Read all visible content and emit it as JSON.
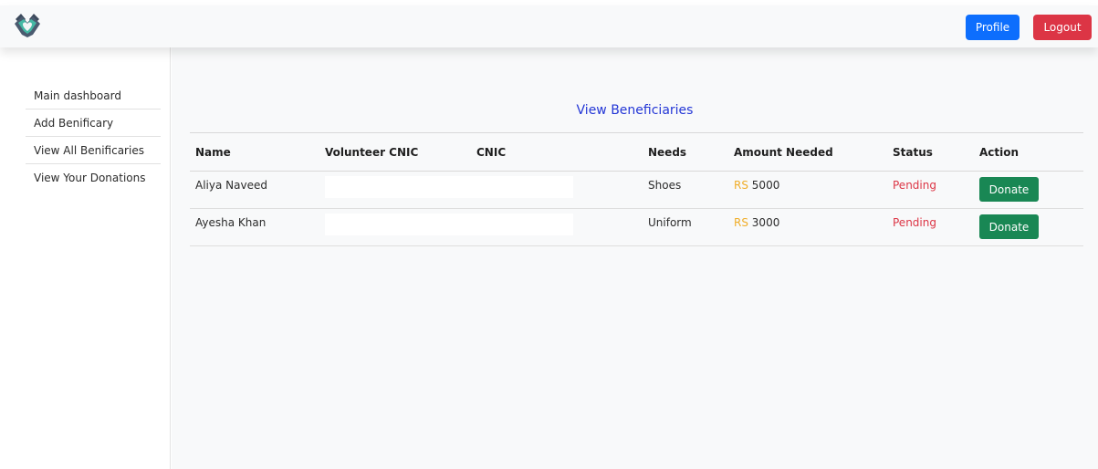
{
  "header": {
    "logo_icon": "hands-heart-icon",
    "profile_label": "Profile",
    "logout_label": "Logout"
  },
  "sidebar": {
    "items": [
      {
        "label": "Main dashboard"
      },
      {
        "label": "Add Benificary"
      },
      {
        "label": "View All Benificaries"
      },
      {
        "label": "View Your Donations"
      }
    ]
  },
  "main": {
    "title": "View Beneficiaries",
    "table": {
      "columns": [
        "Name",
        "Volunteer CNIC",
        "CNIC",
        "Needs",
        "Amount Needed",
        "Status",
        "Action"
      ],
      "currency_prefix": "RS",
      "rows": [
        {
          "name": "Aliya Naveed",
          "volunteer_cnic": "",
          "cnic": "",
          "needs": "Shoes",
          "amount": "5000",
          "status": "Pending",
          "action": "Donate"
        },
        {
          "name": "Ayesha Khan",
          "volunteer_cnic": "",
          "cnic": "",
          "needs": "Uniform",
          "amount": "3000",
          "status": "Pending",
          "action": "Donate"
        }
      ]
    }
  },
  "colors": {
    "profile_button": "#0d6efd",
    "logout_button": "#dc3545",
    "donate_button": "#198754",
    "title": "#2437d6",
    "currency": "#f0ad28",
    "status_pending": "#dc3545"
  }
}
